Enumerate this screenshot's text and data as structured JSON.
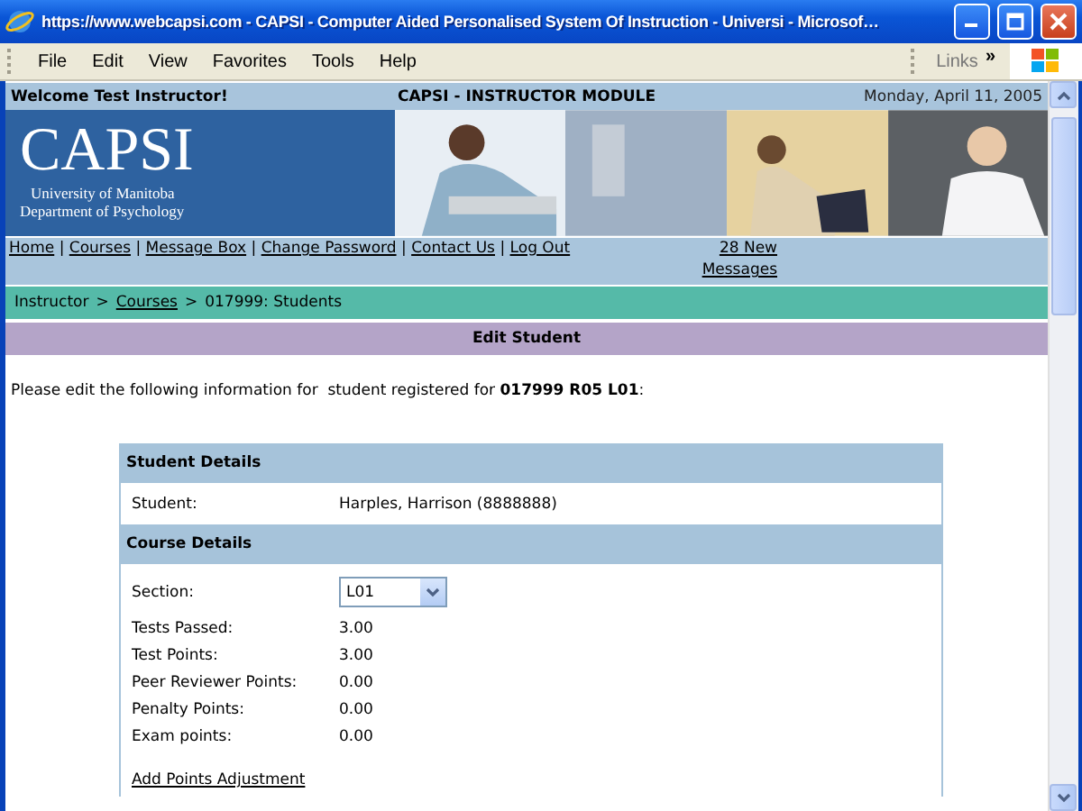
{
  "window": {
    "title": "https://www.webcapsi.com - CAPSI - Computer Aided Personalised System Of Instruction - Universi - Microsof…"
  },
  "menu": [
    "File",
    "Edit",
    "View",
    "Favorites",
    "Tools",
    "Help"
  ],
  "links_bar": {
    "label": "Links",
    "chevron": "»"
  },
  "header": {
    "welcome": "Welcome Test Instructor!",
    "module": "CAPSI - INSTRUCTOR MODULE",
    "date": "Monday, April 11, 2005"
  },
  "logo": {
    "name": "CAPSI",
    "lines": [
      "University of Manitoba",
      "Department of Psychology"
    ]
  },
  "nav": {
    "links": [
      "Home",
      "Courses",
      "Message Box",
      "Change Password",
      "Contact Us",
      "Log Out"
    ],
    "separator": "|",
    "messages": "28 New Messages"
  },
  "breadcrumb": {
    "separator": ">",
    "items": [
      {
        "text": "Instructor",
        "link": false
      },
      {
        "text": "Courses",
        "link": true
      },
      {
        "text": "017999: Students",
        "link": false
      }
    ]
  },
  "section_title": "Edit Student",
  "intro": "Please edit the following information for  student registered for **017999 R05 L01**:",
  "student_details": {
    "title": "Student Details",
    "rows": [
      {
        "kind": "text",
        "label": "Student:",
        "value": "Harples, Harrison (8888888)"
      }
    ]
  },
  "course_details": {
    "title": "Course Details",
    "rows": [
      {
        "kind": "select",
        "label": "Section:",
        "value": "L01"
      },
      {
        "kind": "text",
        "label": "Tests Passed:",
        "value": "3.00"
      },
      {
        "kind": "text",
        "label": "Test Points:",
        "value": "3.00"
      },
      {
        "kind": "text",
        "label": "Peer Reviewer Points:",
        "value": "0.00"
      },
      {
        "kind": "text",
        "label": "Penalty Points:",
        "value": "0.00"
      },
      {
        "kind": "text",
        "label": "Exam points:",
        "value": "0.00"
      }
    ],
    "link": "Add Points Adjustment"
  }
}
